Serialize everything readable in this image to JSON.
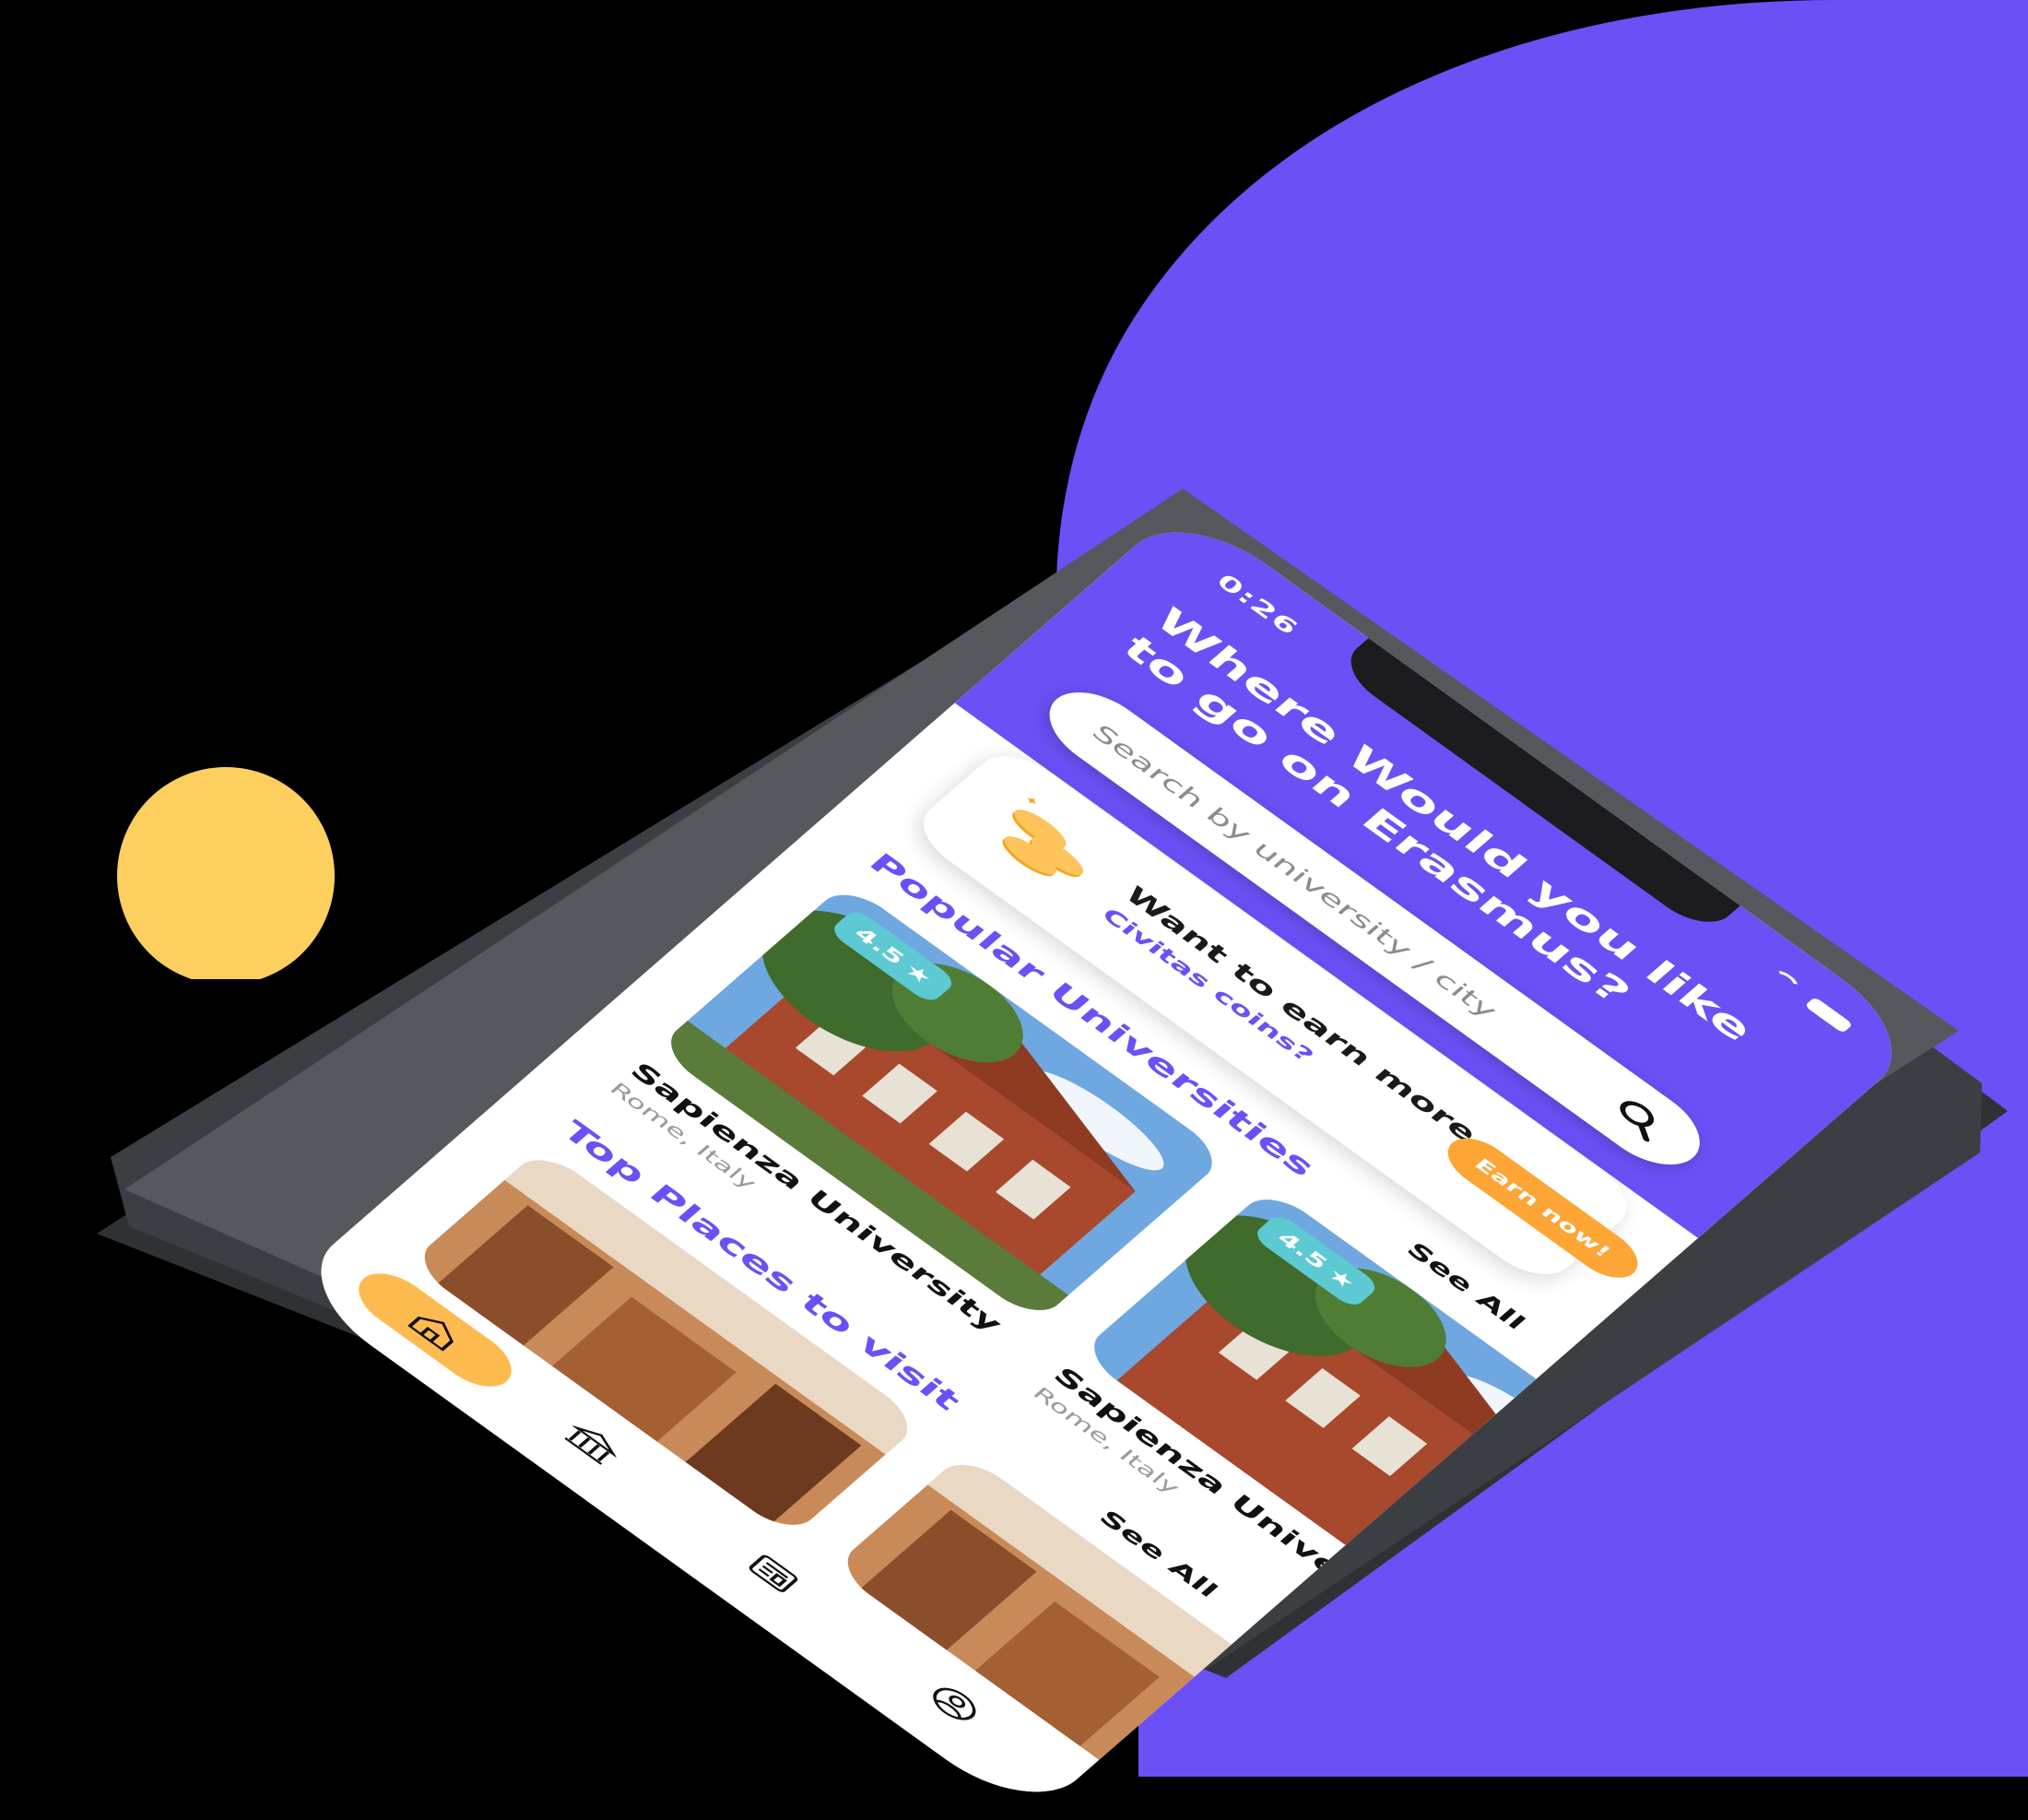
{
  "status_bar": {
    "time": "0:26"
  },
  "header": {
    "title": "Where Would you like to go on Erasmus?",
    "search_placeholder": "Search by university / city"
  },
  "earn_card": {
    "title": "Want to earn more",
    "subtitle": "Civitas coins?",
    "button_label": "Earn now!"
  },
  "popular_universities": {
    "title": "Popular Universities",
    "see_all_label": "See All",
    "items": [
      {
        "name": "Sapienza University",
        "location": "Rome, Italy",
        "rating": "4.5"
      },
      {
        "name": "Sapienza University",
        "location": "Rome, Italy",
        "rating": "4.5"
      }
    ]
  },
  "top_places": {
    "title": "Top Places to visit",
    "see_all_label": "See All"
  },
  "tab_bar": {
    "tabs": [
      {
        "icon": "home-icon",
        "active": true
      },
      {
        "icon": "university-icon",
        "active": false
      },
      {
        "icon": "news-icon",
        "active": false
      },
      {
        "icon": "profile-icon",
        "active": false
      }
    ]
  },
  "colors": {
    "accent": "#6b50f6",
    "orange": "#fda535",
    "yellow": "#fdbb4f",
    "teal": "#5cc9d3",
    "phone_body": "#4a4e52"
  }
}
